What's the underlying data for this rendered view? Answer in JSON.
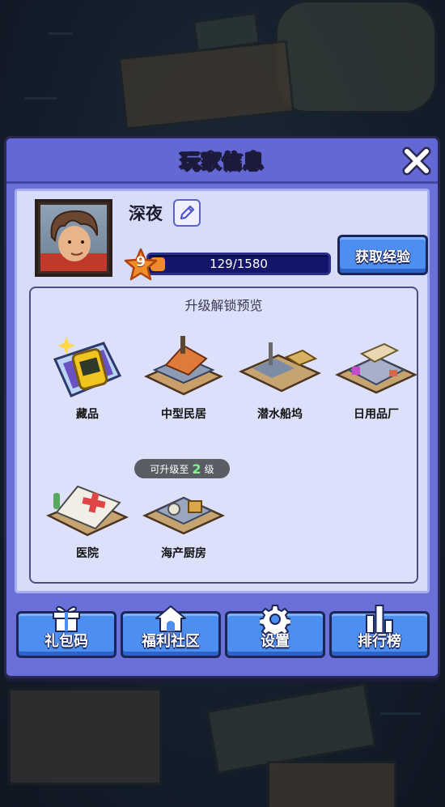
{
  "dialog": {
    "title": "玩家信息"
  },
  "player": {
    "name": "深夜",
    "level": "9",
    "xp_text": "129/1580",
    "xp_progress": 0.082
  },
  "buttons": {
    "get_exp": "获取经验"
  },
  "preview": {
    "title": "升级解锁预览",
    "items": [
      {
        "label": "藏品",
        "icon": "watch-icon"
      },
      {
        "label": "中型民居",
        "icon": "house-raft-icon"
      },
      {
        "label": "潜水船坞",
        "icon": "dock-raft-icon"
      },
      {
        "label": "日用品厂",
        "icon": "factory-raft-icon"
      },
      {
        "label": "医院",
        "icon": "hospital-tent-icon"
      },
      {
        "label": "海产厨房",
        "icon": "kitchen-raft-icon"
      }
    ],
    "badge": {
      "prefix": "可升级至",
      "level": "2",
      "suffix": "级"
    }
  },
  "bottom_buttons": [
    {
      "label": "礼包码",
      "icon": "gift-icon"
    },
    {
      "label": "福利社区",
      "icon": "home-icon"
    },
    {
      "label": "设置",
      "icon": "gear-icon"
    },
    {
      "label": "排行榜",
      "icon": "ranking-bars-icon"
    }
  ],
  "colors": {
    "panel": "#6a70d8",
    "button": "#4c8ff0",
    "xp_fill": "#f08c2a",
    "badge_level": "#7df58a"
  }
}
